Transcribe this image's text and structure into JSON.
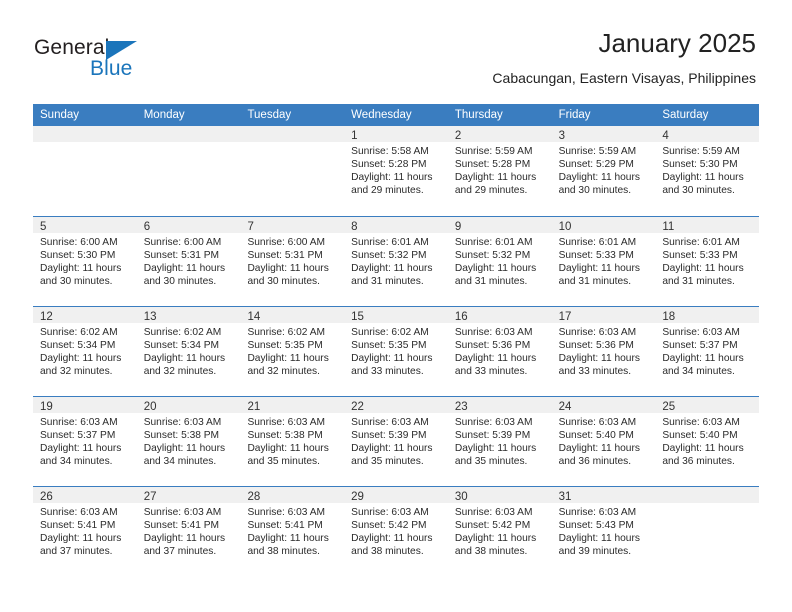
{
  "logo": {
    "word_top": "General",
    "word_bottom": "Blue",
    "triangle_color": "#1b75bb",
    "text_color": "#231f20"
  },
  "header": {
    "title": "January 2025",
    "subtitle": "Cabacungan, Eastern Visayas, Philippines"
  },
  "theme": {
    "header_row_bg": "#3a7dc0",
    "header_row_text": "#ffffff",
    "day_head_bg": "#f0f0f0",
    "row_separator": "#3a7dc0",
    "page_bg": "#ffffff"
  },
  "weekdays": [
    "Sunday",
    "Monday",
    "Tuesday",
    "Wednesday",
    "Thursday",
    "Friday",
    "Saturday"
  ],
  "weeks": [
    [
      {
        "day": "",
        "empty": true
      },
      {
        "day": "",
        "empty": true
      },
      {
        "day": "",
        "empty": true
      },
      {
        "day": "1",
        "sunrise": "Sunrise: 5:58 AM",
        "sunset": "Sunset: 5:28 PM",
        "daylight_1": "Daylight: 11 hours",
        "daylight_2": "and 29 minutes."
      },
      {
        "day": "2",
        "sunrise": "Sunrise: 5:59 AM",
        "sunset": "Sunset: 5:28 PM",
        "daylight_1": "Daylight: 11 hours",
        "daylight_2": "and 29 minutes."
      },
      {
        "day": "3",
        "sunrise": "Sunrise: 5:59 AM",
        "sunset": "Sunset: 5:29 PM",
        "daylight_1": "Daylight: 11 hours",
        "daylight_2": "and 30 minutes."
      },
      {
        "day": "4",
        "sunrise": "Sunrise: 5:59 AM",
        "sunset": "Sunset: 5:30 PM",
        "daylight_1": "Daylight: 11 hours",
        "daylight_2": "and 30 minutes."
      }
    ],
    [
      {
        "day": "5",
        "sunrise": "Sunrise: 6:00 AM",
        "sunset": "Sunset: 5:30 PM",
        "daylight_1": "Daylight: 11 hours",
        "daylight_2": "and 30 minutes."
      },
      {
        "day": "6",
        "sunrise": "Sunrise: 6:00 AM",
        "sunset": "Sunset: 5:31 PM",
        "daylight_1": "Daylight: 11 hours",
        "daylight_2": "and 30 minutes."
      },
      {
        "day": "7",
        "sunrise": "Sunrise: 6:00 AM",
        "sunset": "Sunset: 5:31 PM",
        "daylight_1": "Daylight: 11 hours",
        "daylight_2": "and 30 minutes."
      },
      {
        "day": "8",
        "sunrise": "Sunrise: 6:01 AM",
        "sunset": "Sunset: 5:32 PM",
        "daylight_1": "Daylight: 11 hours",
        "daylight_2": "and 31 minutes."
      },
      {
        "day": "9",
        "sunrise": "Sunrise: 6:01 AM",
        "sunset": "Sunset: 5:32 PM",
        "daylight_1": "Daylight: 11 hours",
        "daylight_2": "and 31 minutes."
      },
      {
        "day": "10",
        "sunrise": "Sunrise: 6:01 AM",
        "sunset": "Sunset: 5:33 PM",
        "daylight_1": "Daylight: 11 hours",
        "daylight_2": "and 31 minutes."
      },
      {
        "day": "11",
        "sunrise": "Sunrise: 6:01 AM",
        "sunset": "Sunset: 5:33 PM",
        "daylight_1": "Daylight: 11 hours",
        "daylight_2": "and 31 minutes."
      }
    ],
    [
      {
        "day": "12",
        "sunrise": "Sunrise: 6:02 AM",
        "sunset": "Sunset: 5:34 PM",
        "daylight_1": "Daylight: 11 hours",
        "daylight_2": "and 32 minutes."
      },
      {
        "day": "13",
        "sunrise": "Sunrise: 6:02 AM",
        "sunset": "Sunset: 5:34 PM",
        "daylight_1": "Daylight: 11 hours",
        "daylight_2": "and 32 minutes."
      },
      {
        "day": "14",
        "sunrise": "Sunrise: 6:02 AM",
        "sunset": "Sunset: 5:35 PM",
        "daylight_1": "Daylight: 11 hours",
        "daylight_2": "and 32 minutes."
      },
      {
        "day": "15",
        "sunrise": "Sunrise: 6:02 AM",
        "sunset": "Sunset: 5:35 PM",
        "daylight_1": "Daylight: 11 hours",
        "daylight_2": "and 33 minutes."
      },
      {
        "day": "16",
        "sunrise": "Sunrise: 6:03 AM",
        "sunset": "Sunset: 5:36 PM",
        "daylight_1": "Daylight: 11 hours",
        "daylight_2": "and 33 minutes."
      },
      {
        "day": "17",
        "sunrise": "Sunrise: 6:03 AM",
        "sunset": "Sunset: 5:36 PM",
        "daylight_1": "Daylight: 11 hours",
        "daylight_2": "and 33 minutes."
      },
      {
        "day": "18",
        "sunrise": "Sunrise: 6:03 AM",
        "sunset": "Sunset: 5:37 PM",
        "daylight_1": "Daylight: 11 hours",
        "daylight_2": "and 34 minutes."
      }
    ],
    [
      {
        "day": "19",
        "sunrise": "Sunrise: 6:03 AM",
        "sunset": "Sunset: 5:37 PM",
        "daylight_1": "Daylight: 11 hours",
        "daylight_2": "and 34 minutes."
      },
      {
        "day": "20",
        "sunrise": "Sunrise: 6:03 AM",
        "sunset": "Sunset: 5:38 PM",
        "daylight_1": "Daylight: 11 hours",
        "daylight_2": "and 34 minutes."
      },
      {
        "day": "21",
        "sunrise": "Sunrise: 6:03 AM",
        "sunset": "Sunset: 5:38 PM",
        "daylight_1": "Daylight: 11 hours",
        "daylight_2": "and 35 minutes."
      },
      {
        "day": "22",
        "sunrise": "Sunrise: 6:03 AM",
        "sunset": "Sunset: 5:39 PM",
        "daylight_1": "Daylight: 11 hours",
        "daylight_2": "and 35 minutes."
      },
      {
        "day": "23",
        "sunrise": "Sunrise: 6:03 AM",
        "sunset": "Sunset: 5:39 PM",
        "daylight_1": "Daylight: 11 hours",
        "daylight_2": "and 35 minutes."
      },
      {
        "day": "24",
        "sunrise": "Sunrise: 6:03 AM",
        "sunset": "Sunset: 5:40 PM",
        "daylight_1": "Daylight: 11 hours",
        "daylight_2": "and 36 minutes."
      },
      {
        "day": "25",
        "sunrise": "Sunrise: 6:03 AM",
        "sunset": "Sunset: 5:40 PM",
        "daylight_1": "Daylight: 11 hours",
        "daylight_2": "and 36 minutes."
      }
    ],
    [
      {
        "day": "26",
        "sunrise": "Sunrise: 6:03 AM",
        "sunset": "Sunset: 5:41 PM",
        "daylight_1": "Daylight: 11 hours",
        "daylight_2": "and 37 minutes."
      },
      {
        "day": "27",
        "sunrise": "Sunrise: 6:03 AM",
        "sunset": "Sunset: 5:41 PM",
        "daylight_1": "Daylight: 11 hours",
        "daylight_2": "and 37 minutes."
      },
      {
        "day": "28",
        "sunrise": "Sunrise: 6:03 AM",
        "sunset": "Sunset: 5:41 PM",
        "daylight_1": "Daylight: 11 hours",
        "daylight_2": "and 38 minutes."
      },
      {
        "day": "29",
        "sunrise": "Sunrise: 6:03 AM",
        "sunset": "Sunset: 5:42 PM",
        "daylight_1": "Daylight: 11 hours",
        "daylight_2": "and 38 minutes."
      },
      {
        "day": "30",
        "sunrise": "Sunrise: 6:03 AM",
        "sunset": "Sunset: 5:42 PM",
        "daylight_1": "Daylight: 11 hours",
        "daylight_2": "and 38 minutes."
      },
      {
        "day": "31",
        "sunrise": "Sunrise: 6:03 AM",
        "sunset": "Sunset: 5:43 PM",
        "daylight_1": "Daylight: 11 hours",
        "daylight_2": "and 39 minutes."
      },
      {
        "day": "",
        "empty": true
      }
    ]
  ]
}
